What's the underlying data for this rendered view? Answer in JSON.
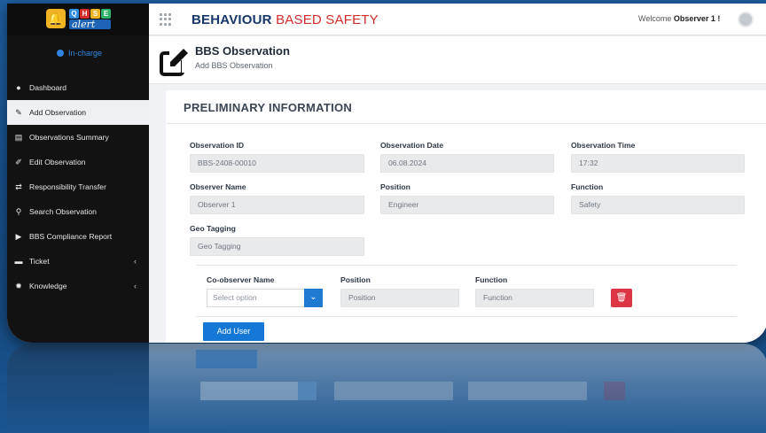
{
  "app": {
    "logo_top_letters": [
      "Q",
      "H",
      "S",
      "E"
    ],
    "logo_top_colors": [
      "#2f8de4",
      "#d52b2b",
      "#f0b323",
      "#2fb36b"
    ],
    "logo_bottom": "alert",
    "brand_bold": "BEHAVIOUR",
    "brand_light": "BASED SAFETY",
    "welcome_prefix": "Welcome",
    "welcome_user": "Observer 1 !"
  },
  "sidebar": {
    "status": "In-charge",
    "items": [
      {
        "label": "Dashboard",
        "icon": "dashboard-icon",
        "glyph": "●",
        "active": false,
        "has_caret": false
      },
      {
        "label": "Add Observation",
        "icon": "edit-icon",
        "glyph": "✎",
        "active": true,
        "has_caret": false
      },
      {
        "label": "Observations Summary",
        "icon": "list-icon",
        "glyph": "▤",
        "active": false,
        "has_caret": false
      },
      {
        "label": "Edit Observation",
        "icon": "pencil-icon",
        "glyph": "✐",
        "active": false,
        "has_caret": false
      },
      {
        "label": "Responsibility Transfer",
        "icon": "transfer-icon",
        "glyph": "⇄",
        "active": false,
        "has_caret": false
      },
      {
        "label": "Search Observation",
        "icon": "search-icon",
        "glyph": "⚲",
        "active": false,
        "has_caret": false
      },
      {
        "label": "BBS Compliance Report",
        "icon": "report-icon",
        "glyph": "▶",
        "active": false,
        "has_caret": false
      },
      {
        "label": "Ticket",
        "icon": "ticket-icon",
        "glyph": "▬",
        "active": false,
        "has_caret": true
      },
      {
        "label": "Knowledge",
        "icon": "lightbulb-icon",
        "glyph": "✹",
        "active": false,
        "has_caret": true
      }
    ]
  },
  "page": {
    "title": "BBS Observation",
    "subtitle": "Add BBS Observation"
  },
  "form": {
    "section_title": "PRELIMINARY INFORMATION",
    "observation_id": {
      "label": "Observation ID",
      "value": "BBS-2408-00010"
    },
    "observation_date": {
      "label": "Observation Date",
      "value": "06.08.2024"
    },
    "observation_time": {
      "label": "Observation Time",
      "value": "17:32"
    },
    "observer_name": {
      "label": "Observer Name",
      "value": "Observer 1"
    },
    "position": {
      "label": "Position",
      "value": "Engineer"
    },
    "function": {
      "label": "Function",
      "value": "Safety"
    },
    "geo_tagging": {
      "label": "Geo Tagging",
      "placeholder": "Geo Tagging"
    },
    "coobserver": {
      "name_label": "Co-observer Name",
      "select_placeholder": "Select option",
      "position_label": "Position",
      "position_placeholder": "Position",
      "function_label": "Function",
      "function_placeholder": "Function"
    },
    "add_user_label": "Add User"
  },
  "colors": {
    "primary": "#1578d6",
    "brand_navy": "#17376b",
    "brand_red": "#d52b2b",
    "danger": "#dc3545",
    "sidebar_bg": "#121212"
  }
}
